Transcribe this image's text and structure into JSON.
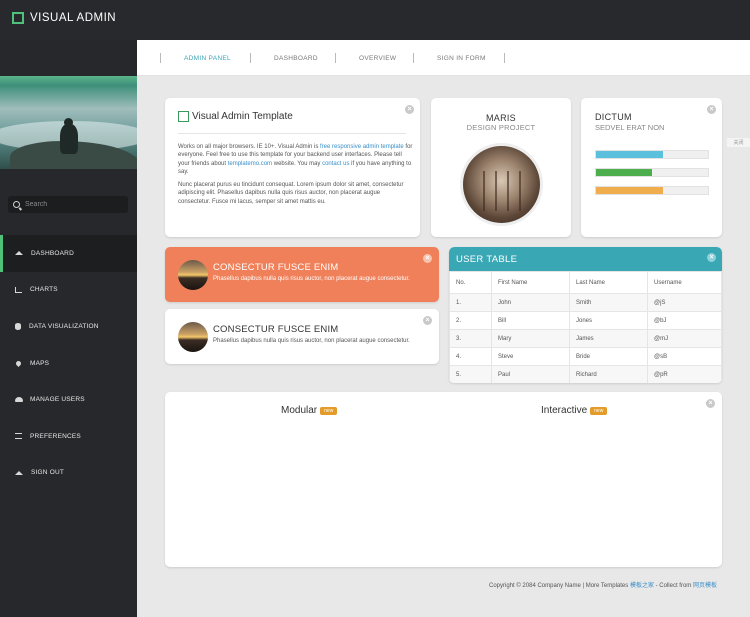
{
  "brand": {
    "title": "VISUAL ADMIN",
    "accent": "#4ec27a"
  },
  "sidebar": {
    "search_placeholder": "Search",
    "items": [
      {
        "label": "DASHBOARD",
        "icon": "home-icon",
        "active": true
      },
      {
        "label": "CHARTS",
        "icon": "bar-chart-icon"
      },
      {
        "label": "DATA VISUALIZATION",
        "icon": "database-icon"
      },
      {
        "label": "MAPS",
        "icon": "map-marker-icon"
      },
      {
        "label": "MANAGE USERS",
        "icon": "users-icon"
      },
      {
        "label": "PREFERENCES",
        "icon": "sliders-icon"
      },
      {
        "label": "SIGN OUT",
        "icon": "eject-icon"
      }
    ]
  },
  "topnav": {
    "items": [
      {
        "label": "ADMIN PANEL",
        "active": true
      },
      {
        "label": "DASHBOARD"
      },
      {
        "label": "OVERVIEW"
      },
      {
        "label": "SIGN IN FORM"
      }
    ],
    "accent": "#3aa6b9"
  },
  "side_tag": "关闭",
  "template_card": {
    "title": "Visual Admin Template",
    "p1_a": "Works on all major browsers. IE 10+. Visual Admin is ",
    "p1_link1": "free responsive admin template",
    "p1_b": " for everyone. Feel free to use this template for your backend user interfaces. Please tell your friends about ",
    "p1_link2": "templatemo.com",
    "p1_c": " website. You may ",
    "p1_link3": "contact us",
    "p1_d": " if you have anything to say.",
    "p2": "Nunc placerat purus eu tincidunt consequat. Lorem ipsum dolor sit amet, consectetur adipiscing elit. Phasellus dapibus nulla quis risus auctor, non placerat augue consectetur. Fusce mi lacus, semper sit amet mattis eu."
  },
  "maris_card": {
    "title": "MARIS",
    "subtitle": "DESIGN PROJECT"
  },
  "dictum_card": {
    "title": "DICTUM",
    "subtitle": "SEDVEL ERAT NON",
    "bars": [
      {
        "value": 60,
        "color": "#5bc0de"
      },
      {
        "value": 50,
        "color": "#4cae4c"
      },
      {
        "value": 60,
        "color": "#f0ad4e"
      }
    ]
  },
  "consectur_cards": [
    {
      "title": "CONSECTUR FUSCE ENIM",
      "text": "Phasellus dapibus nulla quis risus auctor, non placerat augue consectetur.",
      "bg": "#f0805a",
      "highlight": true
    },
    {
      "title": "CONSECTUR FUSCE ENIM",
      "text": "Phasellus dapibus nulla quis risus auctor, non placerat augue consectetur.",
      "bg": "#ffffff",
      "highlight": false
    }
  ],
  "user_table": {
    "title": "USER TABLE",
    "header_color": "#3aa7b5",
    "columns": [
      "No.",
      "First Name",
      "Last Name",
      "Username"
    ],
    "rows": [
      [
        "1.",
        "John",
        "Smith",
        "@jS"
      ],
      [
        "2.",
        "Bill",
        "Jones",
        "@bJ"
      ],
      [
        "3.",
        "Mary",
        "James",
        "@mJ"
      ],
      [
        "4.",
        "Steve",
        "Bride",
        "@sB"
      ],
      [
        "5.",
        "Paul",
        "Richard",
        "@pR"
      ]
    ]
  },
  "bottom_card": {
    "left_label": "Modular",
    "right_label": "Interactive",
    "badge": "new",
    "badge_color": "#e39b2a"
  },
  "footer": {
    "text": "Copyright © 2084 Company Name | More Templates ",
    "link1": "模板之家",
    "mid": " - Collect from ",
    "link2": "网页模板"
  }
}
